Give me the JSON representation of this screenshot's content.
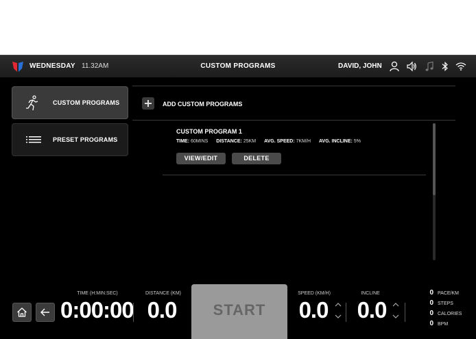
{
  "topbar": {
    "day": "WEDNESDAY",
    "time": "11.32AM",
    "title": "CUSTOM PROGRAMS",
    "user": "DAVID, JOHN",
    "icons": [
      "user-icon",
      "volume-icon",
      "music-icon",
      "bluetooth-icon",
      "wifi-icon"
    ]
  },
  "sidebar": {
    "items": [
      {
        "label": "CUSTOM PROGRAMS",
        "icon": "runner-icon",
        "active": true
      },
      {
        "label": "PRESET PROGRAMS",
        "icon": "list-icon",
        "active": false
      }
    ]
  },
  "main": {
    "add_label": "ADD CUSTOM PROGRAMS",
    "programs": [
      {
        "name": "CUSTOM PROGRAM 1",
        "time_label": "TIME:",
        "time_value": "60MINS",
        "distance_label": "DISTANCE:",
        "distance_value": "25KM",
        "speed_label": "AVG. SPEED:",
        "speed_value": "7KM/H",
        "incline_label": "AVG. INCLINE:",
        "incline_value": "5%",
        "view_label": "VIEW/EDIT",
        "delete_label": "DELETE"
      }
    ]
  },
  "bottom": {
    "time_label": "TIME (H:MIN:SEC)",
    "time_value": "0:00:00",
    "distance_label": "DISTANCE (KM)",
    "distance_value": "0.0",
    "start_label": "START",
    "speed_label": "SPEED (KM/H)",
    "speed_value": "0.0",
    "incline_label": "INCLINE",
    "incline_value": "0.0",
    "stats": [
      {
        "value": "0",
        "label": "PACE/KM"
      },
      {
        "value": "0",
        "label": "STEPS"
      },
      {
        "value": "0",
        "label": "CALORIES"
      },
      {
        "value": "0",
        "label": "BPM"
      }
    ]
  },
  "colors": {
    "logo_red": "#e02935",
    "logo_blue": "#2a6fd6",
    "background": "#000000",
    "start_button": "#9a9a9a"
  }
}
